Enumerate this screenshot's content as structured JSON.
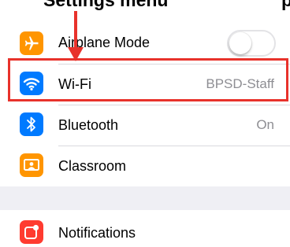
{
  "caption": {
    "text": "Settings menu",
    "tail": "p"
  },
  "settings": {
    "airplane_mode": {
      "label": "Airplane Mode",
      "icon": "airplane-icon",
      "color": "#ff9500",
      "toggle_on": false
    },
    "wifi": {
      "label": "Wi-Fi",
      "value": "BPSD-Staff",
      "icon": "wifi-icon",
      "color": "#007aff"
    },
    "bluetooth": {
      "label": "Bluetooth",
      "value": "On",
      "icon": "bluetooth-icon",
      "color": "#007aff"
    },
    "classroom": {
      "label": "Classroom",
      "icon": "classroom-icon",
      "color": "#ff9500"
    },
    "notifications": {
      "label": "Notifications",
      "icon": "notifications-icon",
      "color": "#ff3b30"
    }
  },
  "annotation": {
    "color": "#e8322b",
    "target": "Wi-Fi"
  }
}
